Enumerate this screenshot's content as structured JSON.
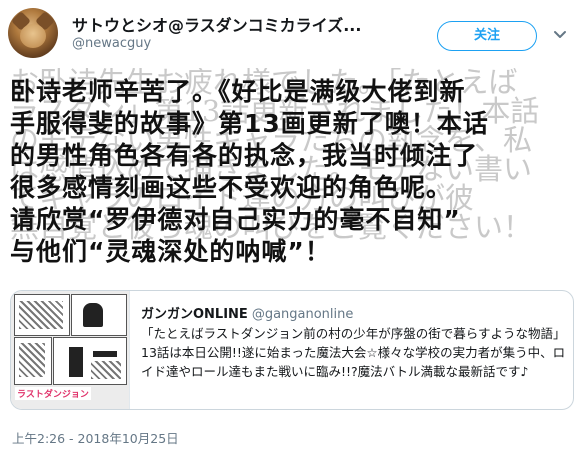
{
  "author": {
    "display_name": "サトウとシオ@ラスダンコミカライズ...",
    "screen_name": "@newacguy",
    "avatar_icon": "cat-avatar"
  },
  "actions": {
    "follow_label": "关注",
    "menu_icon": "chevron-down-icon"
  },
  "tweet": {
    "text_zh": "卧诗老师辛苦了。《好比是满级大佬到新\n手服得斐的故事》第13画更新了噢！本话\n的男性角色各有各的执念，我当时倾注了\n很多感情刻画这些不受欢迎的角色呢。\n请欣赏“罗伊德对自己实力的毫不自知”\n与他们“灵魂深处的呐喊”！",
    "text_ja_background": "お卧诗先生お疲れ様でした。「たとえば\nラスダン」第13話更新されました！本話\nのモテない男性キャラたちの執念を、私\nは感情込めて描きました。モテない書い\nてキャラのロイド達の方の叫びが彼\n無自覚と彼ら魂の叫びをご覧ください！"
  },
  "quote": {
    "name": "ガンガンONLINE",
    "handle": "@ganganonline",
    "text": "「たとえばラストダンジョン前の村の少年が序盤の街で暮らすような物語」13話は本日公開!!遂に始まった魔法大会☆様々な学校の実力者が集う中、ロイド達やロール達もまた戦いに臨み!!?魔法バトル満載な最新話です♪",
    "thumb_caption": "ラストダンジョン"
  },
  "timestamp": "上午2:26 - 2018年10月25日",
  "colors": {
    "accent": "#1da1f2",
    "secondary_text": "#657786",
    "border": "#ccd6dd"
  }
}
